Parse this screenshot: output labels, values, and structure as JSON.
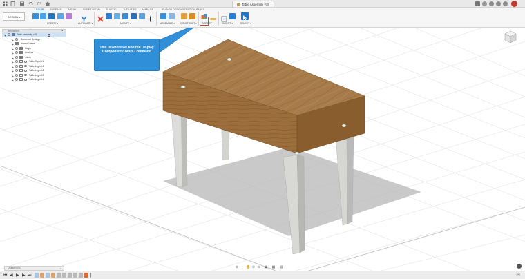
{
  "window": {
    "title": "Table Assembly v15",
    "left_icons": [
      "grid-icon",
      "file-icon",
      "save-icon",
      "undo-icon",
      "redo-icon",
      "home-icon"
    ],
    "right_icons": [
      "plus-icon",
      "extensions-icon",
      "online-status-icon",
      "notifications-icon",
      "help-icon",
      "profile-icon"
    ]
  },
  "ribbon": {
    "workspace": "DESIGN ▾",
    "tabs": [
      "SOLID",
      "SURFACE",
      "MESH",
      "SHEET METAL",
      "PLASTIC",
      "UTILITIES",
      "MANAGE",
      "FUSION DEMONSTRATION PANEL"
    ],
    "active_tab": "SOLID",
    "groups": [
      "CREATE ▾",
      "AUTOMATE ▾",
      "MODIFY ▾",
      "ASSEMBLE ▾",
      "CONSTRUCT ▾",
      "INSPECT ▾",
      "INSERT ▾",
      "SELECT ▾"
    ]
  },
  "browser": {
    "title": "BROWSER",
    "items": [
      {
        "label": "Table Assembly v15",
        "level": 0
      },
      {
        "label": "Document Settings",
        "level": 1
      },
      {
        "label": "Named Views",
        "level": 1
      },
      {
        "label": "Origin",
        "level": 1
      },
      {
        "label": "Analysis",
        "level": 1
      },
      {
        "label": "Joints",
        "level": 1
      },
      {
        "label": "Table Top v3:1",
        "level": 1
      },
      {
        "label": "Table Leg v4:1",
        "level": 1
      },
      {
        "label": "Table Leg v4:2",
        "level": 1
      },
      {
        "label": "Table Leg v4:3",
        "level": 1
      },
      {
        "label": "Table Leg v4:4",
        "level": 1
      }
    ]
  },
  "callout": {
    "text": "This is where we find the Display Component Colors Command"
  },
  "comments": {
    "title": "COMMENTS"
  },
  "colors": {
    "accent": "#2a7fd4",
    "callout_bg": "#2f8fd8",
    "highlight": "#e03b2f",
    "wood_top": "#a47a48",
    "leg": "#d9d9d6"
  }
}
